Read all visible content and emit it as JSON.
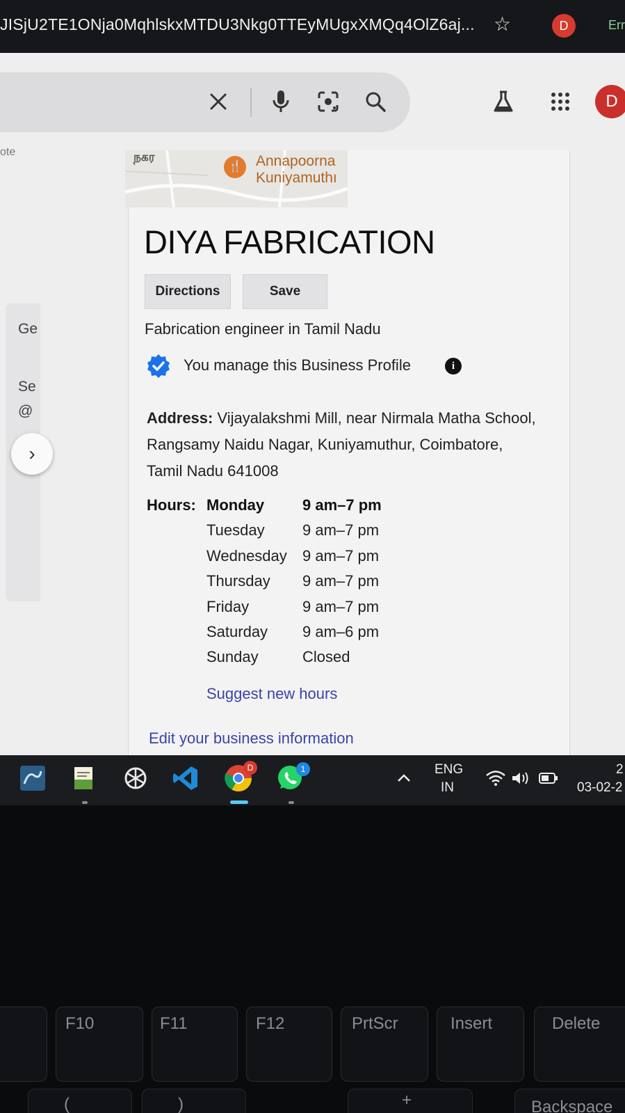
{
  "browser": {
    "url_fragment": "JISjU2TE1ONja0MqhlskxMTDU3Nkg0TTEyMUgxXMQq4OlZ6aj...",
    "profile_initial": "D",
    "extension_label": "Err"
  },
  "search": {
    "clear_icon": "close-icon",
    "voice_icon": "mic-icon",
    "lens_icon": "lens-icon",
    "search_icon": "search-icon"
  },
  "header": {
    "labs_icon": "flask-icon",
    "apps_icon": "grid-icon",
    "avatar_initial": "D"
  },
  "left_panel": {
    "line1": "Ge",
    "line2": "Se",
    "line3": "@",
    "top_fragment": "ote"
  },
  "map": {
    "tamil_label": "நகர",
    "place_line1": "Annapoorna",
    "place_line2": "Kuniyamuthı"
  },
  "business": {
    "name": "DIYA FABRICATION",
    "directions_label": "Directions",
    "save_label": "Save",
    "category": "Fabrication engineer in Tamil Nadu",
    "manage_text": "You manage this Business Profile",
    "address_label": "Address:",
    "address_value": "Vijayalakshmi Mill, near Nirmala Matha School, Rangsamy Naidu Nagar, Kuniyamuthur, Coimbatore, Tamil Nadu 641008",
    "hours_label": "Hours:",
    "hours": [
      {
        "day": "Monday",
        "time": "9 am–7 pm"
      },
      {
        "day": "Tuesday",
        "time": "9 am–7 pm"
      },
      {
        "day": "Wednesday",
        "time": "9 am–7 pm"
      },
      {
        "day": "Thursday",
        "time": "9 am–7 pm"
      },
      {
        "day": "Friday",
        "time": "9 am–7 pm"
      },
      {
        "day": "Saturday",
        "time": "9 am–6 pm"
      },
      {
        "day": "Sunday",
        "time": "Closed"
      }
    ],
    "suggest_hours": "Suggest new hours",
    "edit_info": "Edit your business information"
  },
  "taskbar": {
    "chrome_badge": "D",
    "whatsapp_badge": "1",
    "lang_line1": "ENG",
    "lang_line2": "IN",
    "time_fragment": "2",
    "date_fragment": "03-02-2"
  },
  "keyboard": {
    "keys": [
      "F10",
      "F11",
      "F12",
      "PrtScr",
      "Insert",
      "Delete"
    ],
    "bottom_keys": [
      "(",
      ")",
      "+",
      "Backspace"
    ]
  },
  "colors": {
    "chrome_dark": "#16171a",
    "page_bg": "#eeeeef",
    "link_blue": "#3b44a6",
    "verified_blue": "#1a73e8",
    "avatar_red": "#c9302c",
    "whatsapp_green": "#25d366"
  }
}
